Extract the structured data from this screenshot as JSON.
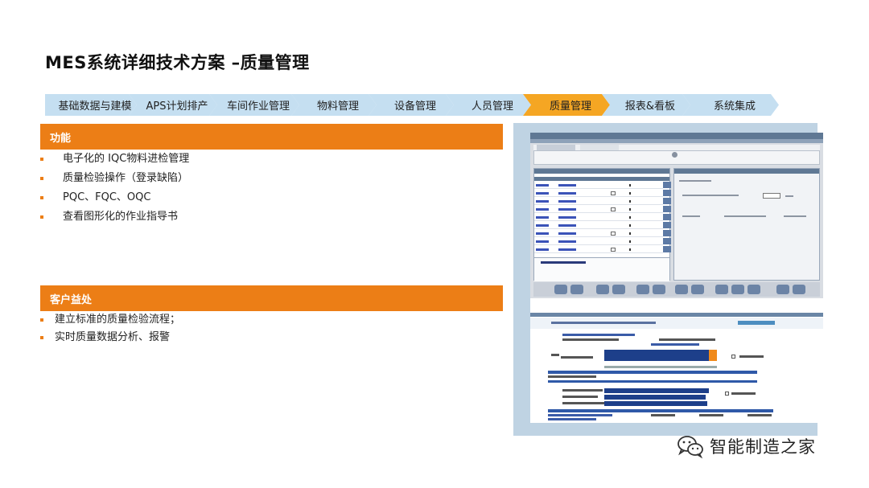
{
  "title": "MES系统详细技术方案 –质量管理",
  "nav": {
    "steps": [
      {
        "label": "基础数据与建模"
      },
      {
        "label": "APS计划排产"
      },
      {
        "label": "车间作业管理"
      },
      {
        "label": "物料管理"
      },
      {
        "label": "设备管理"
      },
      {
        "label": "人员管理"
      },
      {
        "label": "质量管理"
      },
      {
        "label": "报表&看板"
      },
      {
        "label": "系统集成"
      }
    ],
    "active_index": 6,
    "colors": {
      "inactive": "#c5dff1",
      "active": "#f5a623"
    }
  },
  "features": {
    "heading": "功能",
    "items": [
      "电子化的 IQC物料进检管理",
      "质量检验操作（登录缺陷）",
      "PQC、FQC、OQC",
      "查看图形化的作业指导书"
    ]
  },
  "benefits": {
    "heading": "客户益处",
    "items": [
      "建立标准的质量检验流程；",
      "实时质量数据分析、报警"
    ]
  },
  "watermark": {
    "text": "智能制造之家",
    "icon": "wechat-icon"
  },
  "colors": {
    "accent": "#ec7e16",
    "frame": "#bfd3e3"
  }
}
